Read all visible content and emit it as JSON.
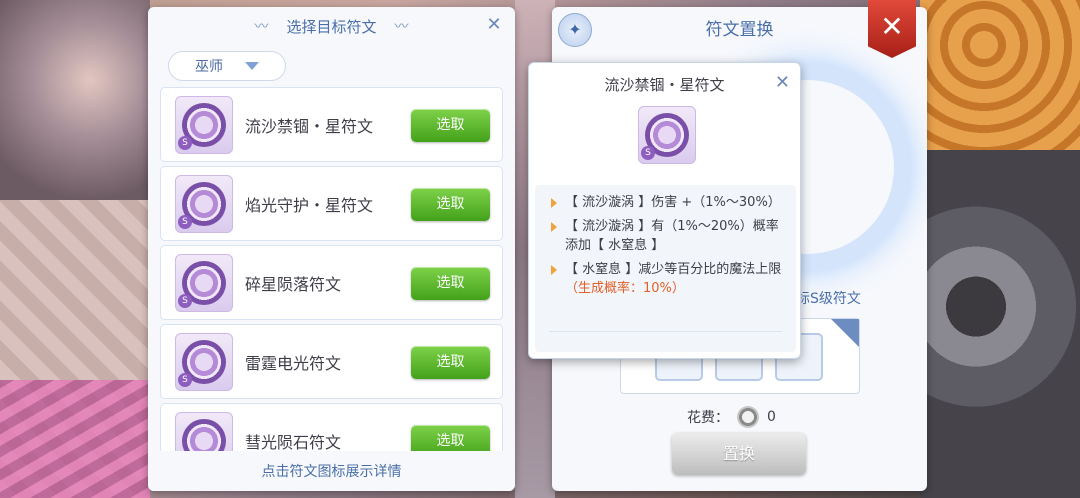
{
  "select_panel": {
    "title": "选择目标符文",
    "filter": "巫师",
    "footer": "点击符文图标展示详情",
    "items": [
      {
        "name": "流沙禁锢・星符文",
        "button": "选取"
      },
      {
        "name": "焰光守护・星符文",
        "button": "选取"
      },
      {
        "name": "碎星陨落符文",
        "button": "选取"
      },
      {
        "name": "雷霆电光符文",
        "button": "选取"
      },
      {
        "name": "彗光陨石符文",
        "button": "选取"
      }
    ]
  },
  "replace_panel": {
    "title": "符文置换",
    "target_label": "标S级符文",
    "cost_label": "花费：",
    "cost_value": "0",
    "replace_button": "置换"
  },
  "tooltip": {
    "title": "流沙禁锢・星符文",
    "lines": [
      "【 流沙漩涡 】伤害 +（1%～30%）",
      "【 流沙漩涡 】有（1%～20%）概率添加【 水窒息 】",
      "【 水窒息 】减少等百分比的魔法上限"
    ],
    "rate": "（生成概率：10%）"
  },
  "icons": {
    "close": "close-icon",
    "wand": "magic-wand-icon",
    "coin": "zeny-coin-icon",
    "dropdown": "chevron-down-icon"
  }
}
